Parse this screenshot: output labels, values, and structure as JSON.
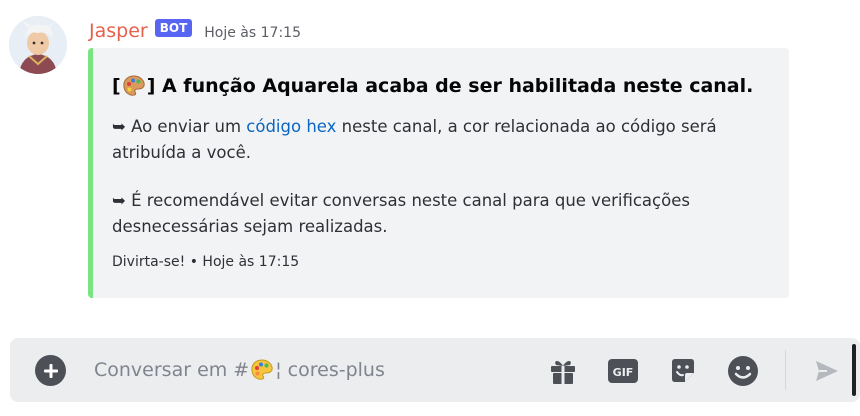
{
  "message": {
    "username": "Jasper",
    "bot_tag": "BOT",
    "timestamp": "Hoje às 17:15",
    "embed": {
      "accent_color": "#7ae482",
      "title_prefix": "[",
      "title_suffix": "] A função Aquarela acaba de ser habilitada neste canal.",
      "desc1_arrow": "➥ ",
      "desc1_pre": "Ao enviar um ",
      "desc1_link": "código hex",
      "desc1_post": " neste canal, a cor relacionada ao código será atribuída a você.",
      "desc2": "➥ É recomendável evitar conversas neste canal para que verificações desnecessárias sejam realizadas.",
      "footer_text": "Divirta-se!",
      "footer_sep": " • ",
      "footer_time": "Hoje às 17:15"
    }
  },
  "composer": {
    "placeholder_pre": "Conversar em #",
    "placeholder_post": " ¦ cores-plus",
    "gif_label": "GIF"
  },
  "icons": {
    "avatar": "avatar",
    "palette": "palette-emoji",
    "plus": "plus-icon",
    "gift": "gift-icon",
    "gif": "gif-icon",
    "sticker": "sticker-icon",
    "emoji": "emoji-icon",
    "send": "send-icon"
  }
}
